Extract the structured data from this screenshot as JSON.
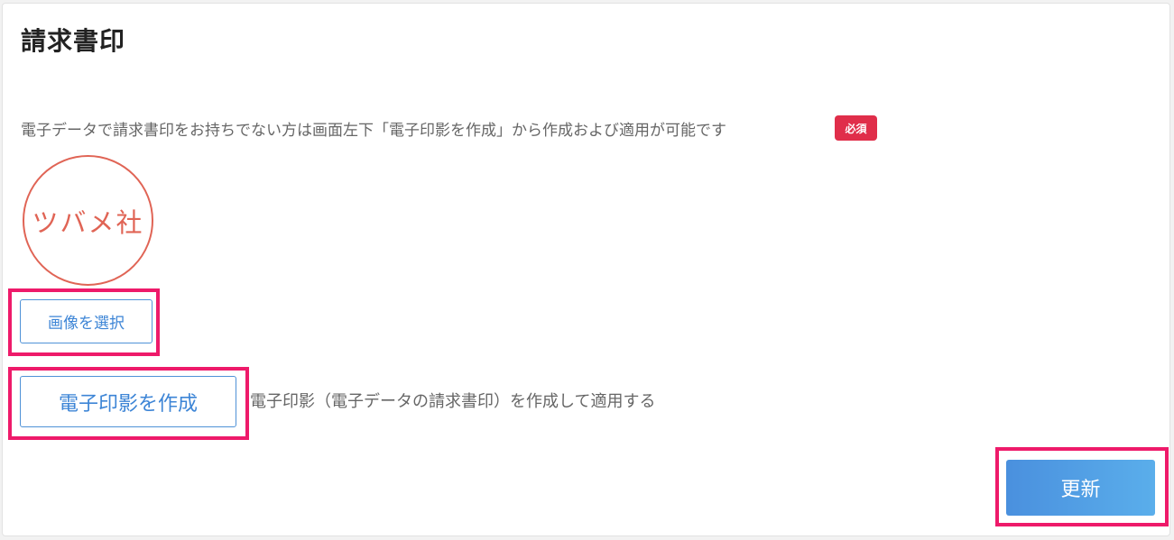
{
  "section": {
    "title": "請求書印",
    "description": "電子データで請求書印をお持ちでない方は画面左下「電子印影を作成」から作成および適用が可能です",
    "required_badge": "必須"
  },
  "seal": {
    "text": "ツバメ社",
    "color": "#e06455"
  },
  "buttons": {
    "select_image": "画像を選択",
    "create_seal": "電子印影を作成",
    "create_seal_description": "電子印影（電子データの請求書印）を作成して適用する",
    "update": "更新"
  },
  "colors": {
    "accent": "#4a90de",
    "required": "#e02e4a",
    "highlight": "#ee1a6a"
  }
}
